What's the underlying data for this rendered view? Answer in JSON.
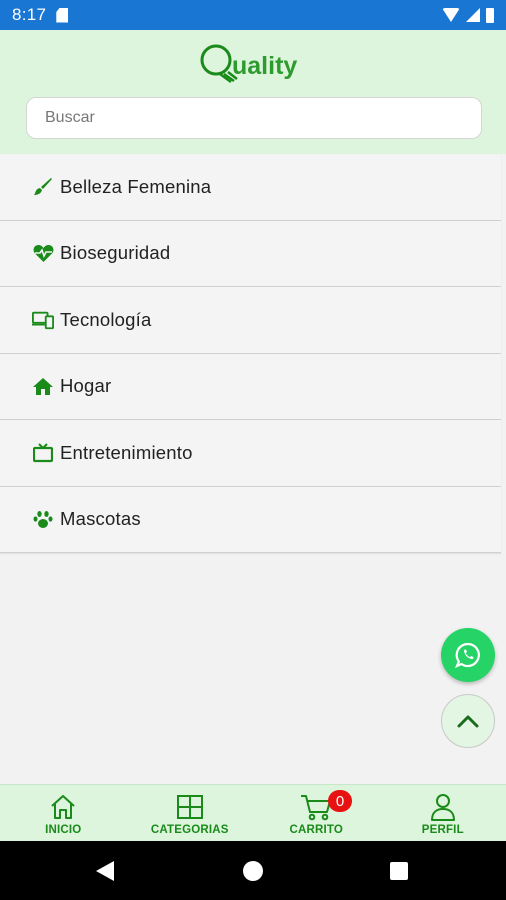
{
  "status_bar": {
    "time": "8:17"
  },
  "header": {
    "logo_text": "Quality",
    "search": {
      "placeholder": "Buscar",
      "value": ""
    }
  },
  "categories": [
    {
      "label": "Belleza Femenina",
      "icon": "brush-icon"
    },
    {
      "label": "Bioseguridad",
      "icon": "heartbeat-icon"
    },
    {
      "label": "Tecnología",
      "icon": "devices-icon"
    },
    {
      "label": "Hogar",
      "icon": "home-icon"
    },
    {
      "label": "Entretenimiento",
      "icon": "tv-icon"
    },
    {
      "label": "Mascotas",
      "icon": "paw-icon"
    }
  ],
  "fabs": {
    "whatsapp_icon": "whatsapp-icon",
    "scroll_top_icon": "chevron-up-icon"
  },
  "bottom_nav": {
    "items": [
      {
        "label": "INICIO",
        "icon": "home-outline-icon"
      },
      {
        "label": "CATEGORIAS",
        "icon": "grid-icon"
      },
      {
        "label": "CARRITO",
        "icon": "cart-icon"
      },
      {
        "label": "PERFIL",
        "icon": "user-icon"
      }
    ],
    "cart_count": "0"
  },
  "colors": {
    "status_bar": "#1976d2",
    "header_bg": "#dcf5dc",
    "accent_green": "#1a8a1a",
    "whatsapp": "#25d366",
    "badge": "#e81212"
  }
}
